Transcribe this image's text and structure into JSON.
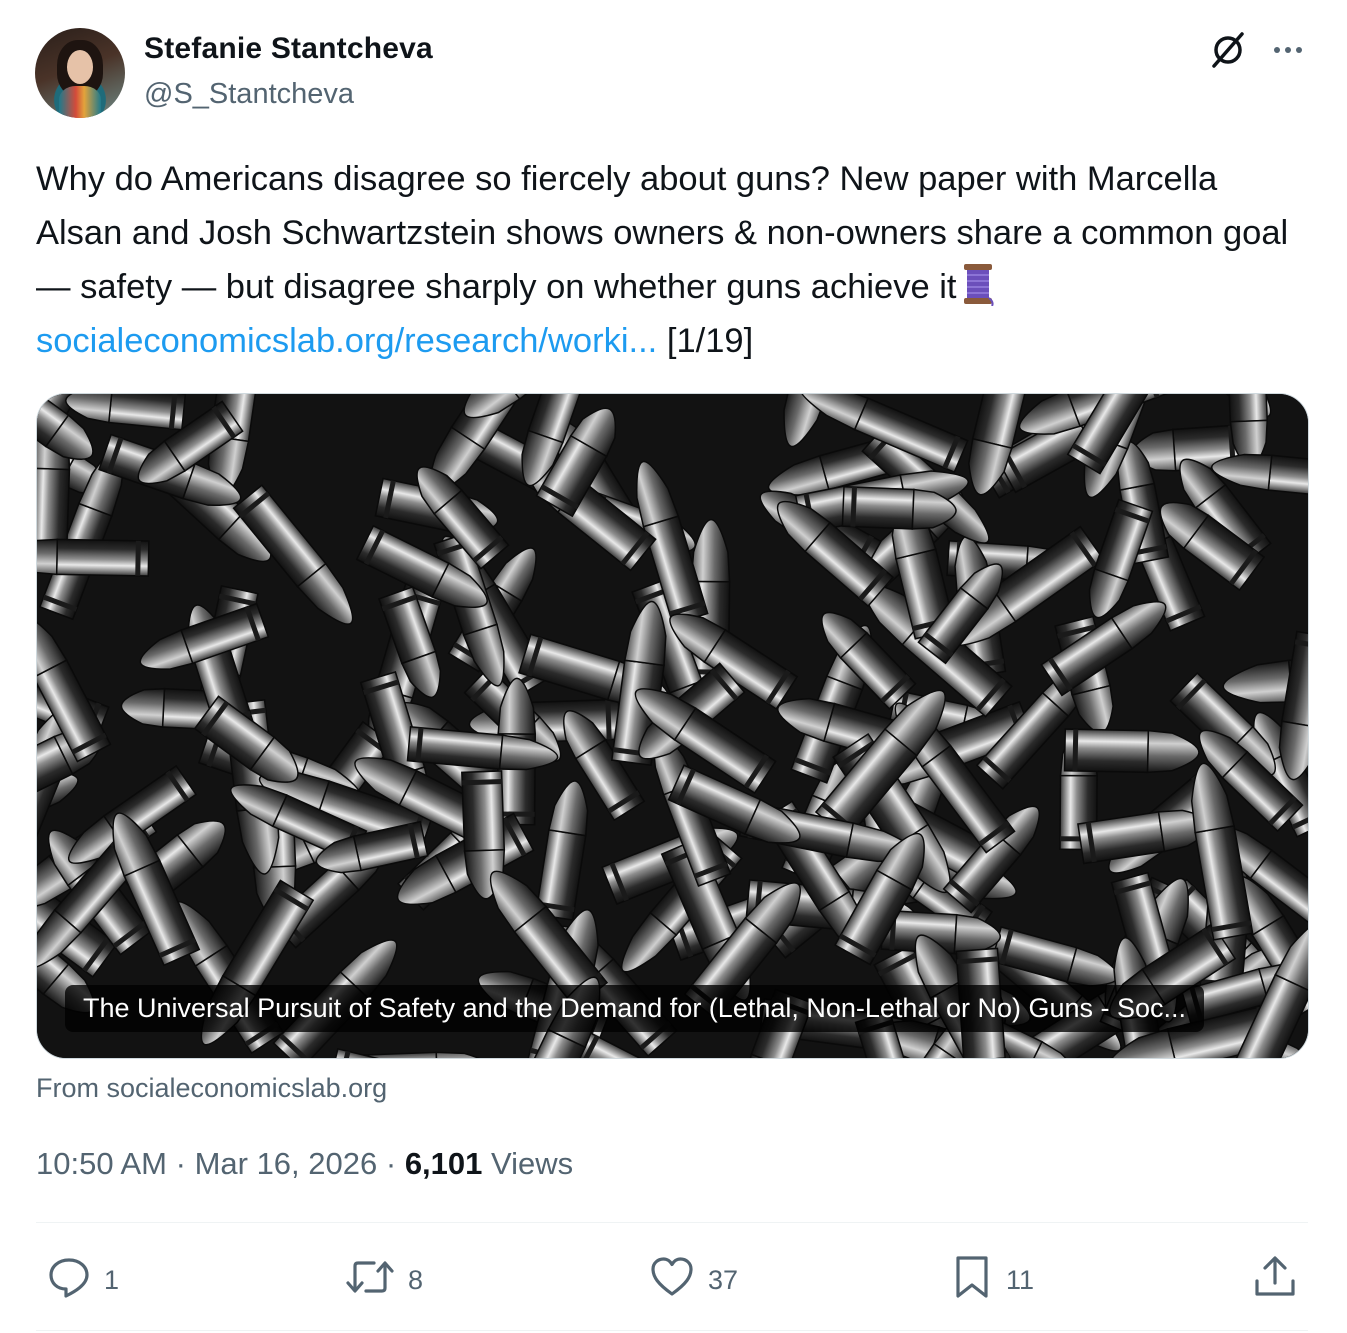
{
  "author": {
    "name": "Stefanie Stantcheva",
    "handle": "@S_Stantcheva"
  },
  "icons": {
    "grok": "slashed-circle-icon",
    "more": "more-horizontal-icon",
    "reply": "reply-icon",
    "retweet": "retweet-icon",
    "like": "heart-icon",
    "bookmark": "bookmark-icon",
    "share": "share-icon",
    "thread": "spool-of-thread-emoji"
  },
  "tweet": {
    "text_before_link": "Why do Americans disagree so fiercely about guns? New paper with Marcella Alsan and Josh Schwartzstein shows owners & non-owners share a common goal — safety — but disagree sharply on whether guns achieve it",
    "link_text": "socialeconomicslab.org/research/worki...",
    "text_after_link": "[1/19]"
  },
  "card": {
    "caption": "The Universal Pursuit of Safety and the Demand for (Lethal, Non-Lethal or No) Guns - Soc...",
    "source": "From socialeconomicslab.org"
  },
  "meta": {
    "time": "10:50 AM",
    "separator": "·",
    "date": "Mar 16, 2026",
    "views_count": "6,101",
    "views_label": "Views"
  },
  "actions": {
    "replies": "1",
    "retweets": "8",
    "likes": "37",
    "bookmarks": "11"
  },
  "colors": {
    "text": "#0f1419",
    "secondary": "#536471",
    "link": "#1d9bf0",
    "divider": "#eff3f4"
  }
}
